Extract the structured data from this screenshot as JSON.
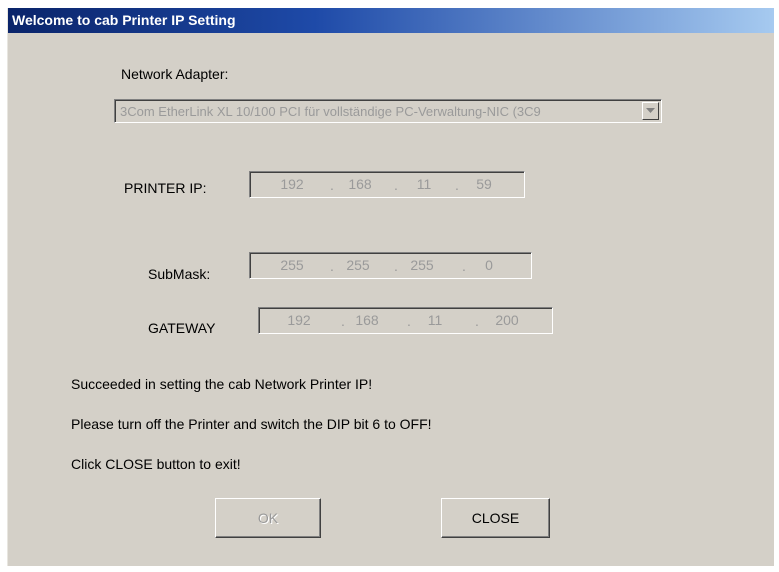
{
  "window": {
    "title": "Welcome to cab Printer IP Setting"
  },
  "adapter": {
    "label": "Network Adapter:",
    "selected": "3Com EtherLink XL 10/100 PCI für vollständige PC-Verwaltung-NIC (3C9"
  },
  "printer_ip": {
    "label": "PRINTER IP:",
    "octets": [
      "192",
      "168",
      "11",
      "59"
    ]
  },
  "submask": {
    "label": "SubMask:",
    "octets": [
      "255",
      "255",
      "255",
      "0"
    ]
  },
  "gateway": {
    "label": "GATEWAY",
    "octets": [
      "192",
      "168",
      "11",
      "200"
    ]
  },
  "messages": [
    "Succeeded in setting the cab Network Printer IP!",
    "Please turn off the Printer and switch the DIP bit 6 to OFF!",
    "Click CLOSE button to exit!"
  ],
  "buttons": {
    "ok": "OK",
    "close": "CLOSE"
  },
  "icons": {
    "dropdown": "chevron-down-icon"
  }
}
